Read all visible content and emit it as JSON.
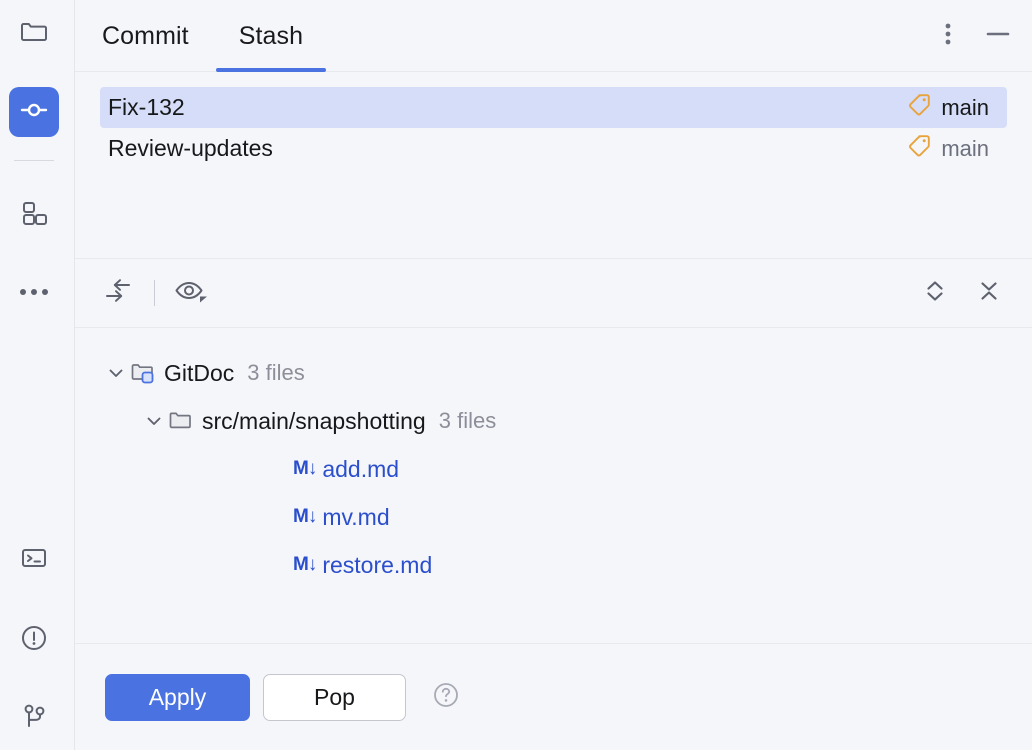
{
  "rail": {
    "items": [
      {
        "name": "project-folder",
        "icon": "folder-icon",
        "active": false
      },
      {
        "name": "version-control",
        "icon": "commit-node-icon",
        "active": true
      },
      {
        "name": "structure",
        "icon": "structure-blocks-icon",
        "active": false
      },
      {
        "name": "more-tool-windows",
        "icon": "ellipsis-icon",
        "active": false
      },
      {
        "name": "terminal",
        "icon": "terminal-icon",
        "active": false
      },
      {
        "name": "problems",
        "icon": "exclamation-circle-icon",
        "active": false
      },
      {
        "name": "git-branches",
        "icon": "branch-icon",
        "active": false
      }
    ]
  },
  "header": {
    "tabs": [
      {
        "label": "Commit",
        "selected": false
      },
      {
        "label": "Stash",
        "selected": true
      }
    ],
    "actions": [
      {
        "name": "more-options-button",
        "icon": "vertical-dots-icon"
      },
      {
        "name": "minimize-button",
        "icon": "minimize-icon"
      }
    ],
    "accent_color": "#4A72E0"
  },
  "stash_list": {
    "rows": [
      {
        "name": "Fix-132",
        "branch": "main",
        "selected": true
      },
      {
        "name": "Review-updates",
        "branch": "main",
        "selected": false
      }
    ],
    "tag_icon_color": "#E8A33D",
    "selected_row_color": "#D5DDF8"
  },
  "toolbar": {
    "left": [
      {
        "name": "show-diff-button",
        "icon": "swap-arrows-icon"
      },
      {
        "name": "preview-diff-button",
        "icon": "eye-dropdown-icon"
      }
    ],
    "right": [
      {
        "name": "expand-all-button",
        "icon": "expand-chevrons-icon"
      },
      {
        "name": "collapse-all-button",
        "icon": "collapse-chevrons-icon"
      }
    ]
  },
  "tree": {
    "nodes": [
      {
        "label": "GitDoc",
        "count": "3 files",
        "icon": "module-folder-icon",
        "type": "module",
        "indent": 0,
        "expanded": true
      },
      {
        "label": "src/main/snapshotting",
        "count": "3 files",
        "icon": "folder-icon",
        "type": "folder",
        "indent": 1,
        "expanded": true
      },
      {
        "label": "add.md",
        "icon": "markdown-icon",
        "badge": "M↓",
        "type": "file",
        "indent": 2
      },
      {
        "label": "mv.md",
        "icon": "markdown-icon",
        "badge": "M↓",
        "type": "file",
        "indent": 2
      },
      {
        "label": "restore.md",
        "icon": "markdown-icon",
        "badge": "M↓",
        "type": "file",
        "indent": 2
      }
    ],
    "file_color": "#2B4FCC"
  },
  "bottom": {
    "apply_label": "Apply",
    "pop_label": "Pop",
    "help": {
      "name": "help-button",
      "icon": "question-circle-icon"
    }
  }
}
